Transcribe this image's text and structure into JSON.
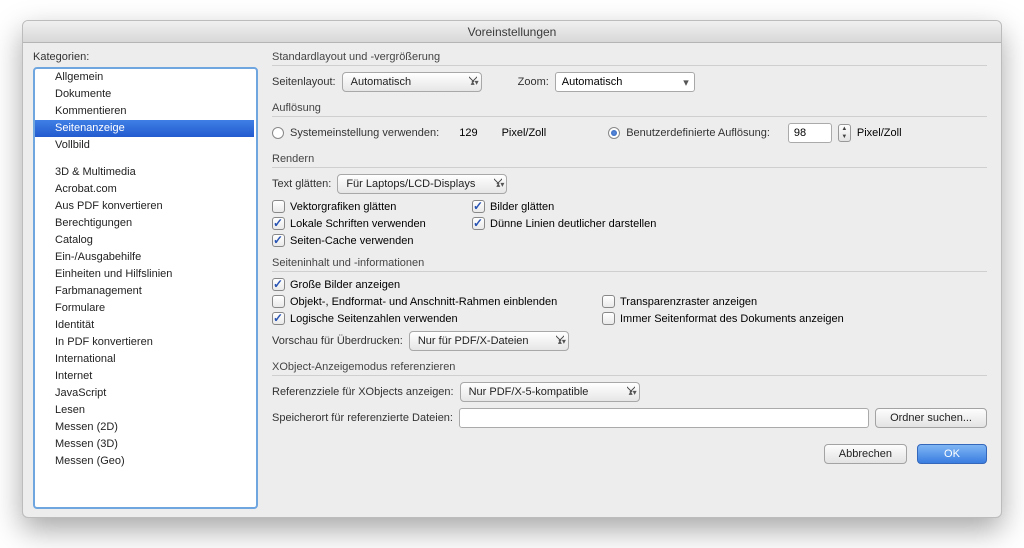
{
  "title": "Voreinstellungen",
  "sidebar": {
    "label": "Kategorien:",
    "groups": [
      [
        "Allgemein",
        "Dokumente",
        "Kommentieren",
        "Seitenanzeige",
        "Vollbild"
      ],
      [
        "3D & Multimedia",
        "Acrobat.com",
        "Aus PDF konvertieren",
        "Berechtigungen",
        "Catalog",
        "Ein-/Ausgabehilfe",
        "Einheiten und Hilfslinien",
        "Farbmanagement",
        "Formulare",
        "Identität",
        "In PDF konvertieren",
        "International",
        "Internet",
        "JavaScript",
        "Lesen",
        "Messen (2D)",
        "Messen (3D)",
        "Messen (Geo)"
      ]
    ],
    "selected": "Seitenanzeige"
  },
  "layout": {
    "section": "Standardlayout und -vergrößerung",
    "page_layout_label": "Seitenlayout:",
    "page_layout_value": "Automatisch",
    "zoom_label": "Zoom:",
    "zoom_value": "Automatisch"
  },
  "resolution": {
    "section": "Auflösung",
    "sys_label": "Systemeinstellung verwenden:",
    "sys_value": "129",
    "sys_unit": "Pixel/Zoll",
    "custom_label": "Benutzerdefinierte Auflösung:",
    "custom_value": "98",
    "custom_unit": "Pixel/Zoll"
  },
  "render": {
    "section": "Rendern",
    "smooth_label": "Text glätten:",
    "smooth_value": "Für Laptops/LCD-Displays",
    "cb_vector": "Vektorgrafiken glätten",
    "cb_images": "Bilder glätten",
    "cb_fonts": "Lokale Schriften verwenden",
    "cb_lines": "Dünne Linien deutlicher darstellen",
    "cb_cache": "Seiten-Cache verwenden"
  },
  "content": {
    "section": "Seiteninhalt und -informationen",
    "cb_big": "Große Bilder anzeigen",
    "cb_boxes": "Objekt-, Endformat- und Anschnitt-Rahmen einblenden",
    "cb_trans": "Transparenzraster anzeigen",
    "cb_logical": "Logische Seitenzahlen verwenden",
    "cb_always": "Immer Seitenformat des Dokuments anzeigen",
    "overprint_label": "Vorschau für Überdrucken:",
    "overprint_value": "Nur für PDF/X-Dateien"
  },
  "xobject": {
    "section": "XObject-Anzeigemodus referenzieren",
    "targets_label": "Referenzziele für XObjects anzeigen:",
    "targets_value": "Nur PDF/X-5-kompatible",
    "location_label": "Speicherort für referenzierte Dateien:",
    "browse": "Ordner suchen..."
  },
  "footer": {
    "cancel": "Abbrechen",
    "ok": "OK"
  }
}
